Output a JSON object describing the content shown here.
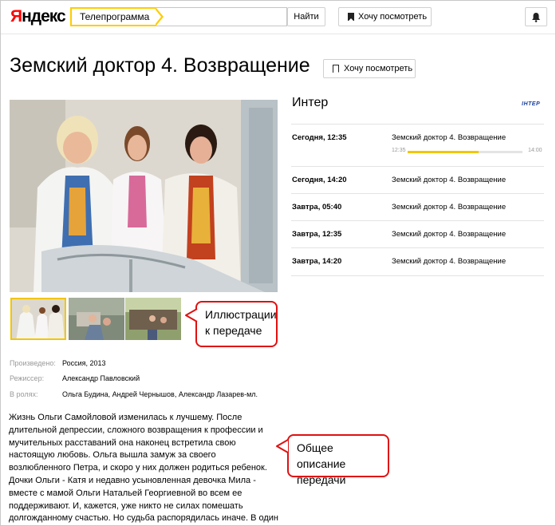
{
  "header": {
    "logo": "Яндекс",
    "search_tag": "Телепрограмма",
    "search_placeholder": "",
    "find_label": "Найти",
    "watch_label": "Хочу посмотреть"
  },
  "program": {
    "title": "Земский доктор 4. Возвращение",
    "watch_label": "Хочу посмотреть",
    "meta": [
      {
        "key": "Произведено:",
        "value": "Россия, 2013"
      },
      {
        "key": "Режиссер:",
        "value": "Александр Павловский"
      },
      {
        "key": "В ролях:",
        "value": "Ольга Будина, Андрей Чернышов, Александр Лазарев-мл."
      }
    ],
    "description": "Жизнь Ольги Самойловой изменилась к лучшему. После длительной депрессии, сложного возвращения к профессии и мучительных расставаний она наконец встретила свою настоящую любовь. Ольга вышла замуж за своего возлюбленного Петра, и скоро у них должен родиться ребенок. Дочки Ольги - Катя и недавно усыновленная девочка Мила - вместе с мамой Ольги Натальей Георгиевной во всем ее поддерживают. И, кажется, уже никто не силах помешать долгожданному счастью. Но судьба распорядилась иначе. В один момент все, что Ольге было дорого, рушится..."
  },
  "callouts": {
    "illustrations": "Иллюстрации к передаче",
    "description": "Общее описание передачи"
  },
  "channel": {
    "name": "Интер",
    "logo_text": "ІНТЕР",
    "schedule": [
      {
        "time": "Сегодня, 12:35",
        "title": "Земский доктор 4. Возвращение",
        "start": "12:35",
        "end": "14:00",
        "progress": 0.62,
        "current": true
      },
      {
        "time": "Сегодня, 14:20",
        "title": "Земский доктор 4. Возвращение"
      },
      {
        "time": "Завтра, 05:40",
        "title": "Земский доктор 4. Возвращение"
      },
      {
        "time": "Завтра, 12:35",
        "title": "Земский доктор 4. Возвращение"
      },
      {
        "time": "Завтра, 14:20",
        "title": "Земский доктор 4. Возвращение"
      }
    ]
  },
  "colors": {
    "accent_yellow": "#ffcc00",
    "logo_red": "#ff0000",
    "callout_red": "#e01010",
    "progress_fill": "#f2c600"
  }
}
